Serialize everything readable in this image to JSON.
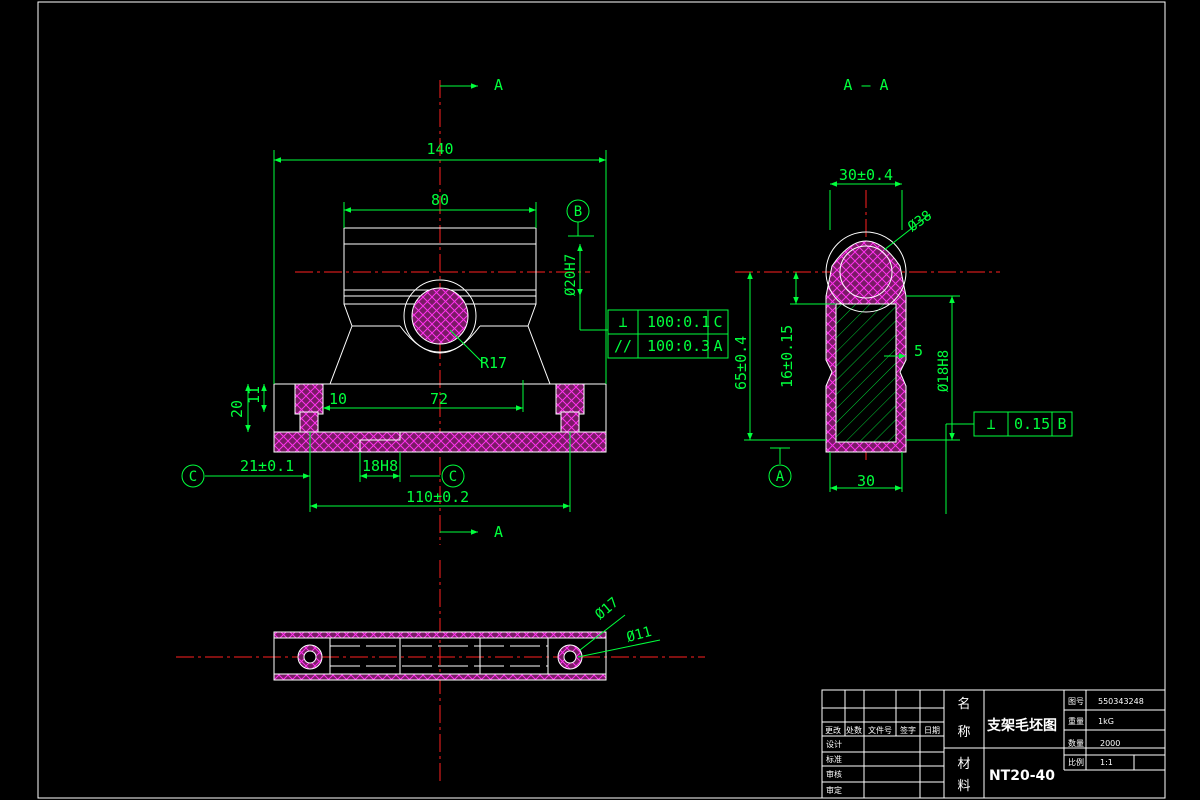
{
  "section_marks": {
    "front_top": "A",
    "front_bottom": "A",
    "side_title": "A — A"
  },
  "datums": {
    "b": "B",
    "c_left": "C",
    "c_right": "C",
    "a": "A"
  },
  "front_view": {
    "overall_width": "140",
    "top_width": "80",
    "bore": "Ø20H7",
    "radius": "R17",
    "base_height": "20",
    "step_height": "11",
    "offset": "10",
    "inner_span": "72",
    "hole_pos": "21±0.1",
    "slot": "18H8",
    "hole_spacing": "110±0.2"
  },
  "tolerance_frames": [
    {
      "symbol": "⊥",
      "value": "100:0.1",
      "datum": "C"
    },
    {
      "symbol": "//",
      "value": "100:0.3",
      "datum": "A"
    }
  ],
  "side_view": {
    "top_width": "30±0.4",
    "top_dia": "Ø38",
    "total_height": "65±0.4",
    "mid_height": "16±0.15",
    "gap": "5",
    "lower_dia": "Ø18H8",
    "bottom_width": "30",
    "tolerance_frame": {
      "symbol": "⊥",
      "value": "0.15",
      "datum": "B"
    }
  },
  "plan_view": {
    "dia_outer": "Ø17",
    "dia_inner": "Ø11"
  },
  "title_block": {
    "name_label_1": "名",
    "name_label_2": "称",
    "part_name": "支架毛坯图",
    "material_label_1": "材",
    "material_label_2": "料",
    "material": "NT20-40",
    "drawing_no_label": "图号",
    "drawing_no": "550343248",
    "weight_label": "重量",
    "weight": "1kG",
    "quantity_label": "数量",
    "quantity": "2000",
    "scale_label": "比例",
    "scale": "1:1",
    "rev_headers": [
      "更改",
      "处数",
      "文件号",
      "签字",
      "日期"
    ],
    "role_labels": [
      "设计",
      "标准",
      "审核",
      "审定"
    ]
  }
}
